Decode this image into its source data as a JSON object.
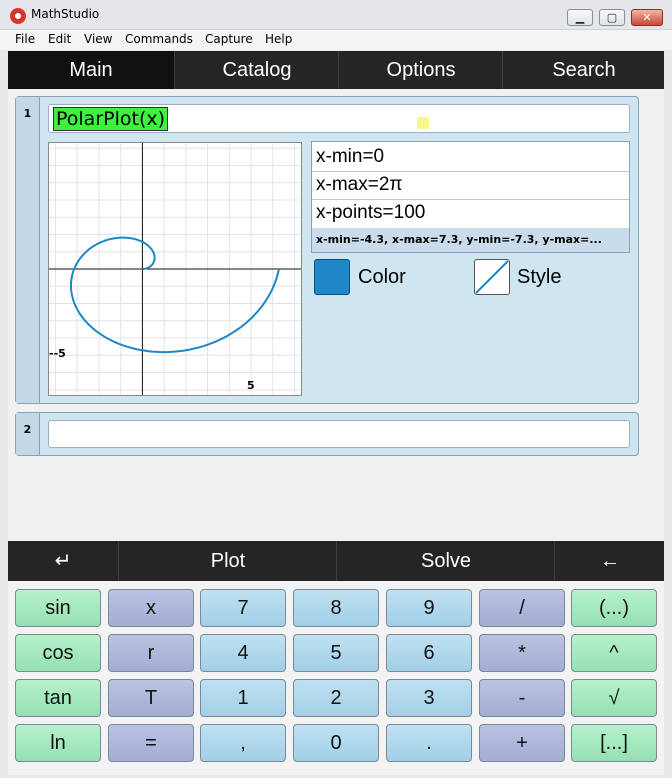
{
  "window": {
    "title": "MathStudio",
    "controls": {
      "minimize": "▁",
      "maximize": "▢",
      "close": "✕"
    }
  },
  "menu": [
    "File",
    "Edit",
    "View",
    "Commands",
    "Capture",
    "Help"
  ],
  "tabs": [
    {
      "label": "Main",
      "active": true
    },
    {
      "label": "Catalog",
      "active": false
    },
    {
      "label": "Options",
      "active": false
    },
    {
      "label": "Search",
      "active": false
    }
  ],
  "cells": [
    {
      "number": "1",
      "expression": "PolarPlot(x)",
      "plot": {
        "tick_labels": {
          "y": "-5",
          "x": "5"
        },
        "curve_color": "#1f86c8",
        "function": "r = x (Archimedean spiral)",
        "x_range": [
          -4.3,
          7.3
        ],
        "y_range": [
          -7.3,
          7.3
        ]
      },
      "params": {
        "xmin": "x-min=0",
        "xmax": "x-max=2π",
        "xpoints": "x-points=100",
        "summary": "x-min=-4.3, x-max=7.3, y-min=-7.3, y-max=..."
      },
      "color_label": "Color",
      "style_label": "Style",
      "color": "#1f86c8"
    },
    {
      "number": "2",
      "expression": ""
    }
  ],
  "actions": {
    "enter": "↵",
    "plot": "Plot",
    "solve": "Solve",
    "back": "←"
  },
  "keypad": [
    [
      "sin",
      "x",
      "7",
      "8",
      "9",
      "/",
      "(...)"
    ],
    [
      "cos",
      "r",
      "4",
      "5",
      "6",
      "*",
      "^"
    ],
    [
      "tan",
      "T",
      "1",
      "2",
      "3",
      "-",
      "√"
    ],
    [
      "ln",
      "=",
      ",",
      "0",
      ".",
      "+",
      "[...]"
    ]
  ],
  "colors": {
    "key_green": "#a6e8c0",
    "key_purple": "#aeb7da",
    "key_blue": "#b0d8ec",
    "bar_dark": "#252525"
  }
}
